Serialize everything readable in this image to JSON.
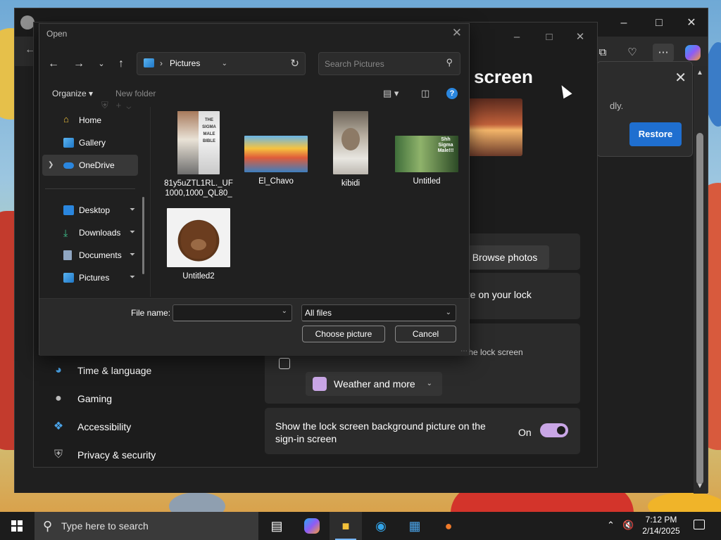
{
  "browser": {
    "tabs": [
      "",
      ""
    ],
    "restore_text": "dly.",
    "restore_button": "Restore",
    "colors": {
      "accent": "#1f6fd0",
      "bg": "#202124"
    }
  },
  "settings": {
    "heading": "screen",
    "browse_photos": "Browse photos",
    "lock_text": "re on your lock",
    "status_text": "the lock screen",
    "weather_button": "Weather and more",
    "signin_text_1": "Show the lock screen background picture on the",
    "signin_text_2": "sign-in screen",
    "toggle_label": "On",
    "toggle_color": "#c9a6e6",
    "nav": [
      "Time & language",
      "Gaming",
      "Accessibility",
      "Privacy & security"
    ]
  },
  "dialog": {
    "title": "Open",
    "location": "Pictures",
    "search_placeholder": "Search Pictures",
    "organize": "Organize",
    "new_folder": "New folder",
    "sidebar": [
      {
        "label": "Home",
        "icon": "home-icon"
      },
      {
        "label": "Gallery",
        "icon": "gallery-icon"
      },
      {
        "label": "OneDrive",
        "icon": "cloud-icon"
      },
      {
        "label": "Desktop",
        "icon": "desktop-icon"
      },
      {
        "label": "Downloads",
        "icon": "download-icon"
      },
      {
        "label": "Documents",
        "icon": "document-icon"
      },
      {
        "label": "Pictures",
        "icon": "pictures-icon"
      }
    ],
    "files": [
      {
        "name": "81y5uZTL1RL._UF1000,1000_QL80_",
        "thumb_text_1": "THE",
        "thumb_text_2": "SIGMA",
        "thumb_text_3": "MALE",
        "thumb_text_4": "BIBLE"
      },
      {
        "name": "El_Chavo"
      },
      {
        "name": "kibidi"
      },
      {
        "name": "Untitled",
        "thumb_text_1": "Shh",
        "thumb_text_2": "Sigma",
        "thumb_text_3": "Male!!!"
      },
      {
        "name": "Untitled2"
      }
    ],
    "file_name_label": "File name:",
    "file_name_value": "",
    "filter": "All files",
    "choose_button": "Choose picture",
    "cancel_button": "Cancel"
  },
  "taskbar": {
    "search_placeholder": "Type here to search",
    "time": "7:12 PM",
    "date": "2/14/2025"
  }
}
